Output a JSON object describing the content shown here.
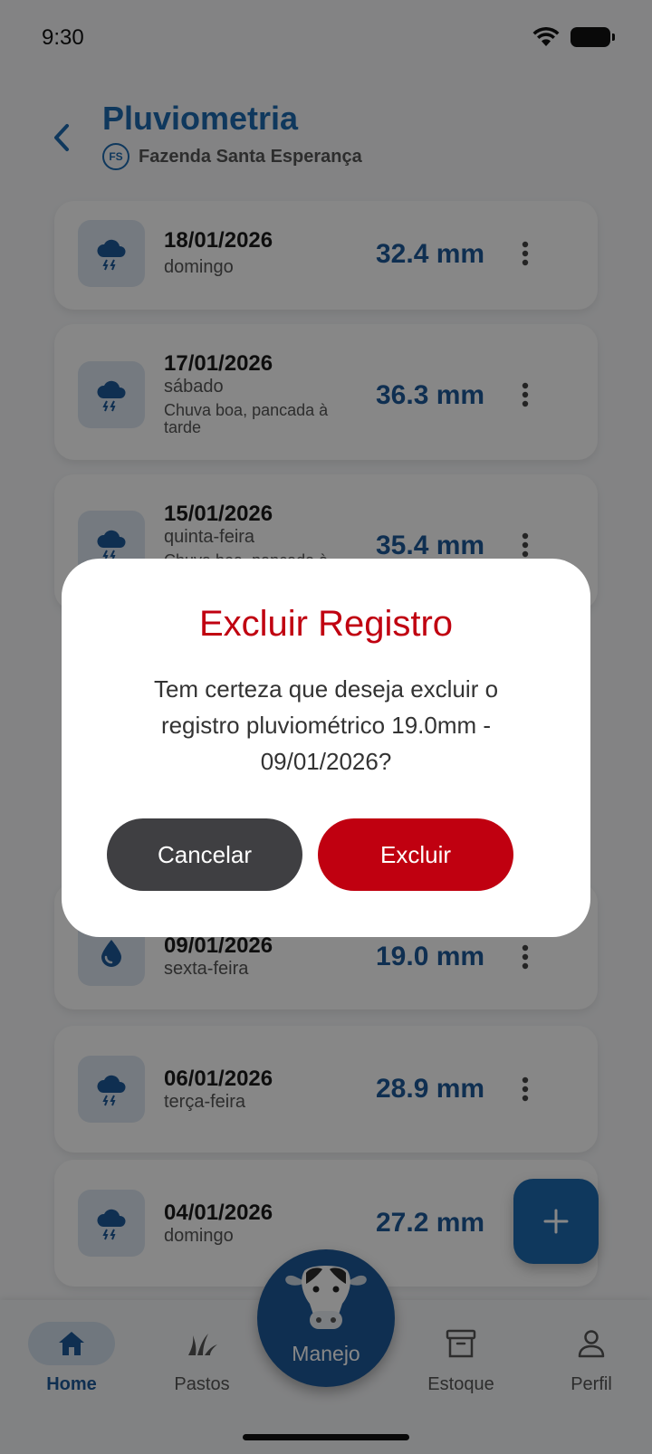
{
  "status_bar": {
    "time": "9:30"
  },
  "header": {
    "title": "Pluviometria",
    "farm_badge": "FS",
    "farm_name": "Fazenda Santa Esperança"
  },
  "records": [
    {
      "date": "18/01/2026",
      "weekday": "domingo",
      "note": "",
      "amount": "32.4 mm",
      "icon": "cloud-lightning-icon"
    },
    {
      "date": "17/01/2026",
      "weekday": "sábado",
      "note": "Chuva boa, pancada à tarde",
      "amount": "36.3 mm",
      "icon": "cloud-lightning-icon"
    },
    {
      "date": "15/01/2026",
      "weekday": "quinta-feira",
      "note": "Chuva boa, pancada à",
      "amount": "35.4 mm",
      "icon": "cloud-lightning-icon"
    },
    {
      "date": "09/01/2026",
      "weekday": "sexta-feira",
      "note": "",
      "amount": "19.0 mm",
      "icon": "water-drop-icon"
    },
    {
      "date": "06/01/2026",
      "weekday": "terça-feira",
      "note": "",
      "amount": "28.9 mm",
      "icon": "cloud-lightning-icon"
    },
    {
      "date": "04/01/2026",
      "weekday": "domingo",
      "note": "",
      "amount": "27.2 mm",
      "icon": "cloud-lightning-icon"
    }
  ],
  "bottom_nav": {
    "home": "Home",
    "pastos": "Pastos",
    "manejo": "Manejo",
    "estoque": "Estoque",
    "perfil": "Perfil"
  },
  "dialog": {
    "title": "Excluir Registro",
    "message": "Tem certeza que deseja excluir o registro pluviométrico 19.0mm - 09/01/2026?",
    "cancel_label": "Cancelar",
    "delete_label": "Excluir"
  },
  "colors": {
    "primary": "#1e6ab0",
    "danger": "#c00010",
    "cancel": "#3f3f42"
  }
}
